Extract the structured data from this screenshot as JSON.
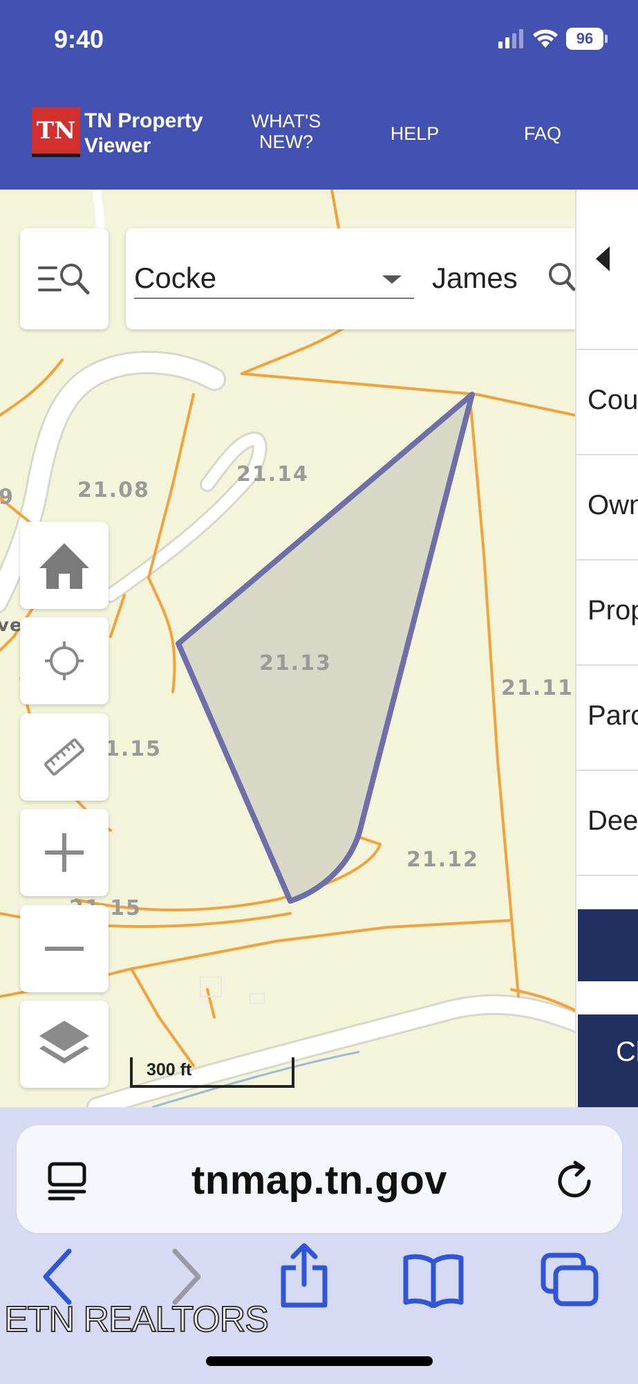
{
  "status_bar": {
    "time": "9:40",
    "battery": "96"
  },
  "header": {
    "logo": "TN",
    "app_title_line1": "TN Property",
    "app_title_line2": "Viewer",
    "nav": [
      {
        "line1": "WHAT'S",
        "line2": "NEW?"
      },
      {
        "line1": "HELP"
      },
      {
        "line1": "FAQ"
      }
    ]
  },
  "search": {
    "county": "Cocke",
    "owner_query": "James"
  },
  "map": {
    "scale": "300 ft",
    "parcel_labels": [
      "21.08",
      "21.14",
      "21.13",
      "21.11",
      "1.15",
      "21.12",
      "21.15",
      "9"
    ],
    "road_label": "ve Way",
    "selected_parcel_color": "#6e6fa8",
    "parcel_line_color": "#f2a23a"
  },
  "side_panel": {
    "rows": [
      "Cou",
      "Own",
      "Prop",
      "Parc",
      "Dee"
    ],
    "button_label": "Cl"
  },
  "browser": {
    "url": "tnmap.tn.gov"
  },
  "watermark": "ETN REALTORS"
}
